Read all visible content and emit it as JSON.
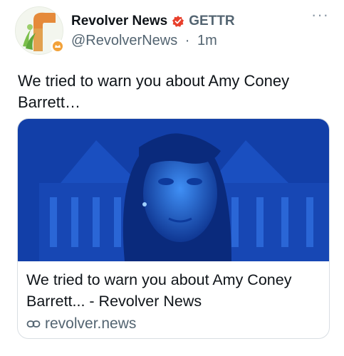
{
  "account": {
    "display_name": "Revolver News",
    "platform_tag": "GETTR",
    "handle": "@RevolverNews",
    "separator": "·",
    "time": "1m",
    "verified_icon": "red-verified-badge-icon",
    "avatar_icon": "revolver-news-logo-icon"
  },
  "tweet": {
    "text": "We tried to warn you about Amy Coney Barrett…"
  },
  "card": {
    "title": "We tried to warn you about Amy Coney Barrett... - Revolver News",
    "domain": "revolver.news",
    "image_tint": "#1f6fe0"
  },
  "menu": {
    "more_label": "···"
  },
  "colors": {
    "text": "#0f1419",
    "secondary": "#536471",
    "verified": "#e8402c",
    "border": "#d9dee3"
  }
}
